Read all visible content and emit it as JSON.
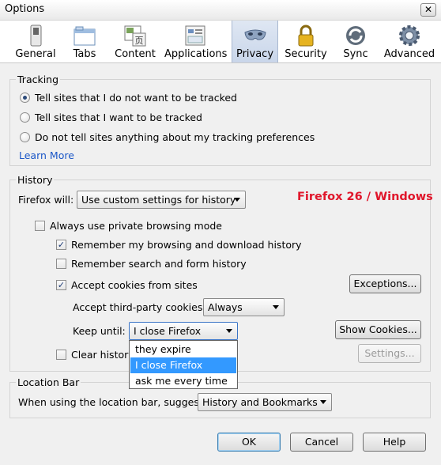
{
  "window": {
    "title": "Options",
    "close_symbol": "✕"
  },
  "toolbar": {
    "tabs": [
      {
        "label": "General",
        "icon": "general-switch-icon"
      },
      {
        "label": "Tabs",
        "icon": "tabs-window-icon"
      },
      {
        "label": "Content",
        "icon": "content-page-icon"
      },
      {
        "label": "Applications",
        "icon": "applications-icon"
      },
      {
        "label": "Privacy",
        "icon": "privacy-mask-icon",
        "active": true
      },
      {
        "label": "Security",
        "icon": "security-lock-icon"
      },
      {
        "label": "Sync",
        "icon": "sync-arrows-icon"
      },
      {
        "label": "Advanced",
        "icon": "advanced-gear-icon"
      }
    ]
  },
  "tracking": {
    "title": "Tracking",
    "options": [
      {
        "label": "Tell sites that I do not want to be tracked",
        "checked": true
      },
      {
        "label": "Tell sites that I want to be tracked",
        "checked": false
      },
      {
        "label": "Do not tell sites anything about my tracking preferences",
        "checked": false
      }
    ],
    "learn_more": "Learn More"
  },
  "history": {
    "title": "History",
    "firefox_will_label": "Firefox will:",
    "firefox_will_value": "Use custom settings for history",
    "always_private": {
      "label": "Always use private browsing mode",
      "checked": false
    },
    "remember_browsing": {
      "label": "Remember my browsing and download history",
      "checked": true
    },
    "remember_search": {
      "label": "Remember search and form history",
      "checked": false
    },
    "accept_cookies": {
      "label": "Accept cookies from sites",
      "checked": true
    },
    "exceptions_button": "Exceptions...",
    "third_party_label": "Accept third-party cookies:",
    "third_party_value": "Always",
    "keep_until_label": "Keep until:",
    "keep_until_value": "I close Firefox",
    "keep_until_options": [
      "they expire",
      "I close Firefox",
      "ask me every time"
    ],
    "keep_until_selected_index": 1,
    "show_cookies_button": "Show Cookies...",
    "clear_history": {
      "label": "Clear history",
      "checked": false
    },
    "settings_button": "Settings..."
  },
  "annotation": {
    "text": "Firefox 26 / Windows",
    "color": "#e0162b"
  },
  "location_bar": {
    "title": "Location Bar",
    "suggest_label": "When using the location bar, suggest:",
    "suggest_value": "History and Bookmarks"
  },
  "footer": {
    "ok": "OK",
    "cancel": "Cancel",
    "help": "Help"
  },
  "colors": {
    "active_tab": "#c9d6ea",
    "link": "#1a56c7",
    "selection": "#3399ff"
  }
}
